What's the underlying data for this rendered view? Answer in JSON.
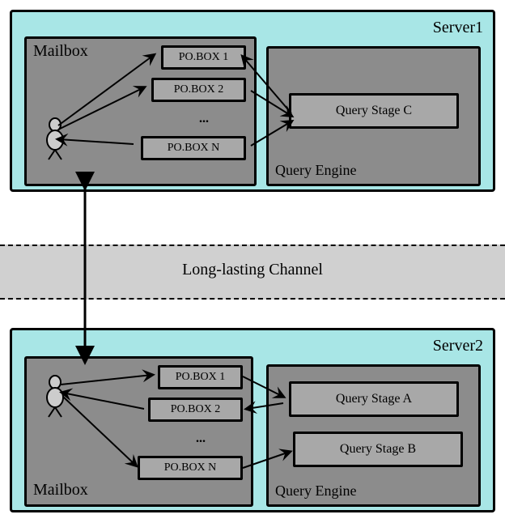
{
  "server1": {
    "label": "Server1",
    "mailbox": {
      "label": "Mailbox",
      "boxes": [
        "PO.BOX 1",
        "PO.BOX 2",
        "PO.BOX N"
      ],
      "ellipsis": "..."
    },
    "engine": {
      "label": "Query Engine",
      "stages": [
        "Query Stage C"
      ]
    }
  },
  "server2": {
    "label": "Server2",
    "mailbox": {
      "label": "Mailbox",
      "boxes": [
        "PO.BOX 1",
        "PO.BOX 2",
        "PO.BOX N"
      ],
      "ellipsis": "..."
    },
    "engine": {
      "label": "Query Engine",
      "stages": [
        "Query Stage A",
        "Query Stage B"
      ]
    }
  },
  "channel": {
    "label": "Long-lasting Channel"
  }
}
